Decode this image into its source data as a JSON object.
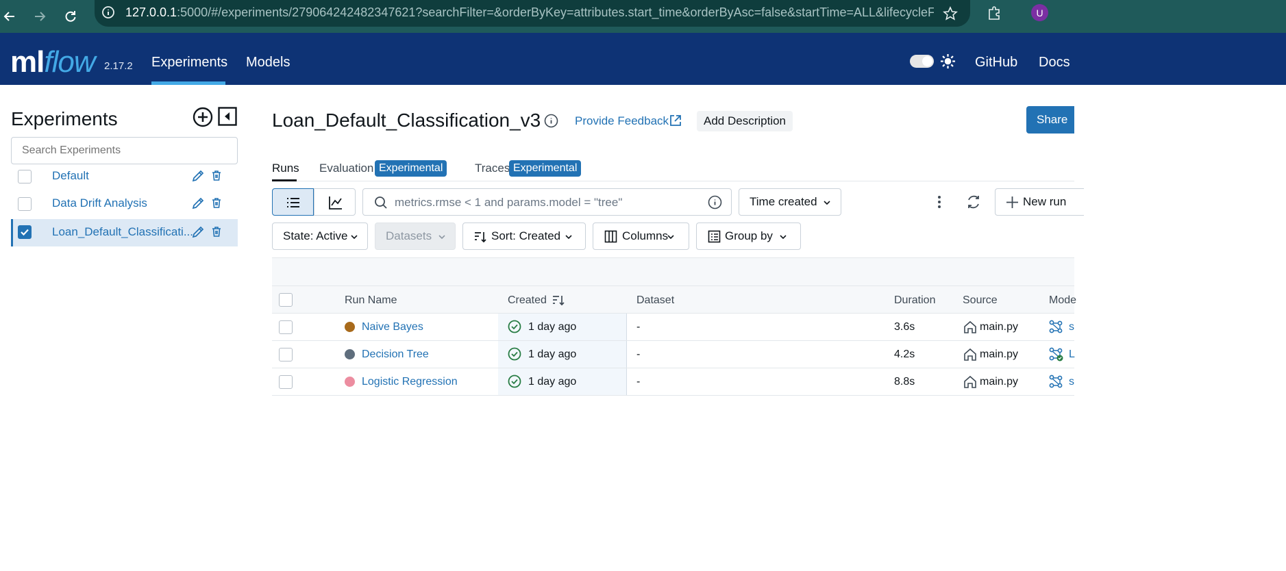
{
  "browser": {
    "url_host": "127.0.0.1",
    "url_rest": ":5000/#/experiments/279064242482347621?searchFilter=&orderByKey=attributes.start_time&orderByAsc=false&startTime=ALL&lifecycleFilte...",
    "avatar_letter": "U"
  },
  "header": {
    "logo_ml": "ml",
    "logo_flow": "flow",
    "version": "2.17.2",
    "nav": [
      "Experiments",
      "Models"
    ],
    "links": [
      "GitHub",
      "Docs"
    ]
  },
  "sidebar": {
    "title": "Experiments",
    "search_placeholder": "Search Experiments",
    "items": [
      {
        "label": "Default",
        "checked": false
      },
      {
        "label": "Data Drift Analysis",
        "checked": false
      },
      {
        "label": "Loan_Default_Classificati...",
        "checked": true
      }
    ]
  },
  "main": {
    "title": "Loan_Default_Classification_v3",
    "feedback": "Provide Feedback",
    "add_description": "Add Description",
    "share": "Share",
    "tabs": [
      {
        "label": "Runs",
        "badge": ""
      },
      {
        "label": "Evaluation",
        "badge": "Experimental"
      },
      {
        "label": "Traces",
        "badge": "Experimental"
      }
    ],
    "filter_placeholder": "metrics.rmse < 1 and params.model = \"tree\"",
    "time_select": "Time created",
    "new_run": "New run",
    "state": "State: Active",
    "datasets": "Datasets",
    "sort": "Sort: Created",
    "columns": "Columns",
    "group_by": "Group by"
  },
  "table": {
    "headers": [
      "Run Name",
      "Created",
      "Dataset",
      "Duration",
      "Source",
      "Mode"
    ],
    "rows": [
      {
        "name": "Naive Bayes",
        "color": "#a86a1b",
        "created": "1 day ago",
        "dataset": "-",
        "duration": "3.6s",
        "source": "main.py",
        "model": "s"
      },
      {
        "name": "Decision Tree",
        "color": "#5f6e7d",
        "created": "1 day ago",
        "dataset": "-",
        "duration": "4.2s",
        "source": "main.py",
        "model": "L"
      },
      {
        "name": "Logistic Regression",
        "color": "#ec8da0",
        "created": "1 day ago",
        "dataset": "-",
        "duration": "8.8s",
        "source": "main.py",
        "model": "s"
      }
    ]
  },
  "colors": {
    "brand": "#0e3375",
    "accent": "#2272b4",
    "success": "#277c43"
  }
}
